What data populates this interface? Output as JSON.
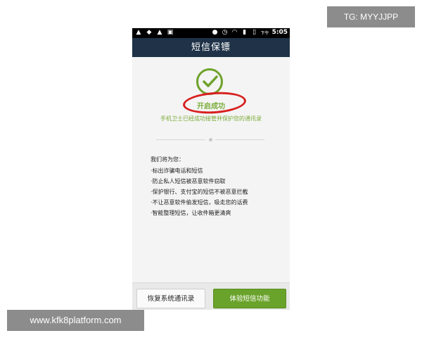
{
  "status_bar": {
    "left_icons": [
      "warning-icon",
      "shield-icon",
      "warning-icon",
      "image-icon"
    ],
    "right_icons": [
      "location-icon",
      "alarm-icon",
      "wifi-icon",
      "signal-icon",
      "battery-icon"
    ],
    "ampm": "下午",
    "time": "5:05"
  },
  "title_bar": {
    "title": "短信保镖"
  },
  "main": {
    "status": "开启成功",
    "subtitle": "手机卫士已经成功接管并保护您的通讯录",
    "features_title": "我们将为您：",
    "features": [
      "·标出诈骗电话和短信",
      "·防止私人短信被恶意软件窃取",
      "·保护银行、支付宝的短信不被恶意拦截",
      "·不让恶意软件偷发短信，吸走您的话费",
      "·智能整理短信，让收件箱更清爽"
    ]
  },
  "bottom": {
    "restore_label": "恢复系统通讯录",
    "try_label": "体验短信功能"
  },
  "watermarks": {
    "tg": "TG: MYYJJPP",
    "url": "www.kfk8platform.com"
  },
  "colors": {
    "accent_green": "#7cad3a",
    "title_bar": "#1f3247",
    "highlight_red": "#d81f1f",
    "button_green": "#6aa32b"
  }
}
